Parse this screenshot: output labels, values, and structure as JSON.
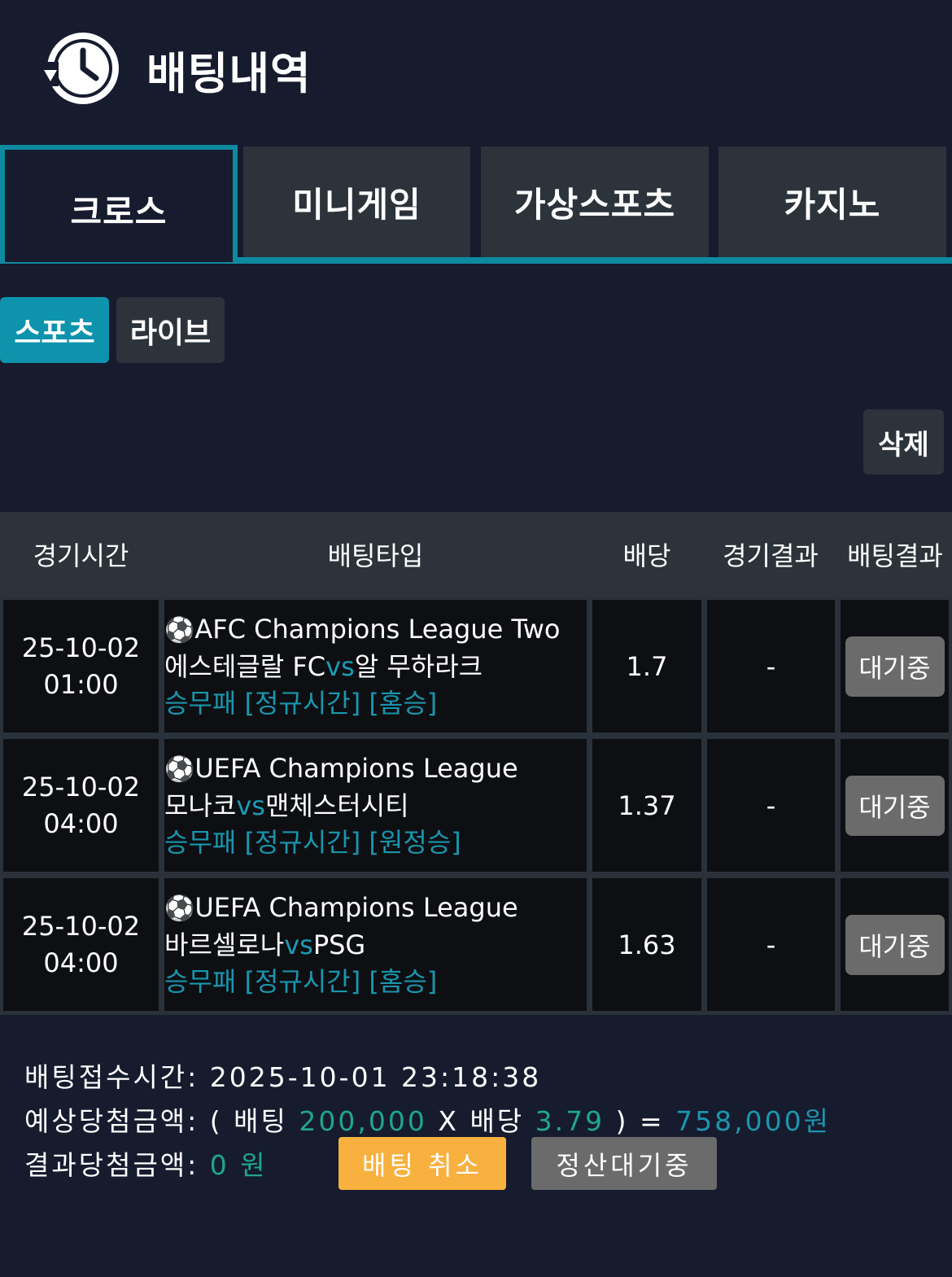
{
  "header": {
    "title": "배팅내역",
    "icon": "history-clock-icon"
  },
  "tabs": [
    {
      "label": "크로스",
      "active": true
    },
    {
      "label": "미니게임",
      "active": false
    },
    {
      "label": "가상스포츠",
      "active": false
    },
    {
      "label": "카지노",
      "active": false
    }
  ],
  "sub_tabs": [
    {
      "label": "스포츠",
      "active": true
    },
    {
      "label": "라이브",
      "active": false
    }
  ],
  "delete_label": "삭제",
  "table": {
    "headers": [
      "경기시간",
      "배팅타입",
      "배당",
      "경기결과",
      "배팅결과"
    ],
    "rows": [
      {
        "date": "25-10-02",
        "time": "01:00",
        "ball": "⚽",
        "league": "AFC Champions League Two",
        "home": "에스테글랄 FC",
        "vs": "vs",
        "away": "알 무하라크",
        "bet_type": "승무패 [정규시간] [홈승]",
        "odds": "1.7",
        "result": "-",
        "status": "대기중"
      },
      {
        "date": "25-10-02",
        "time": "04:00",
        "ball": "⚽",
        "league": "UEFA Champions League",
        "home": "모나코",
        "vs": "vs",
        "away": "맨체스터시티",
        "bet_type": "승무패 [정규시간] [원정승]",
        "odds": "1.37",
        "result": "-",
        "status": "대기중"
      },
      {
        "date": "25-10-02",
        "time": "04:00",
        "ball": "⚽",
        "league": "UEFA Champions League",
        "home": "바르셀로나",
        "vs": "vs",
        "away": "PSG",
        "bet_type": "승무패 [정규시간] [홈승]",
        "odds": "1.63",
        "result": "-",
        "status": "대기중"
      }
    ]
  },
  "summary": {
    "received_label": "배팅접수시간:",
    "received_time": "2025-10-01 23:18:38",
    "expected_label": "예상당첨금액:",
    "expected_open": "( 배팅",
    "bet_amount": "200,000",
    "x_label": "X 배당",
    "total_odds": "3.79",
    "expected_close": ") =",
    "expected_amount": "758,000원",
    "result_label": "결과당첨금액:",
    "result_amount": "0 원",
    "cancel_label": "배팅 취소",
    "settle_label": "정산대기중"
  },
  "colors": {
    "background": "#161b2e",
    "accent": "#0e8aa0",
    "tab_bg": "#2c333b",
    "cancel": "#f8b13e",
    "pending": "#6b6b6b",
    "green": "#1ea78a"
  }
}
